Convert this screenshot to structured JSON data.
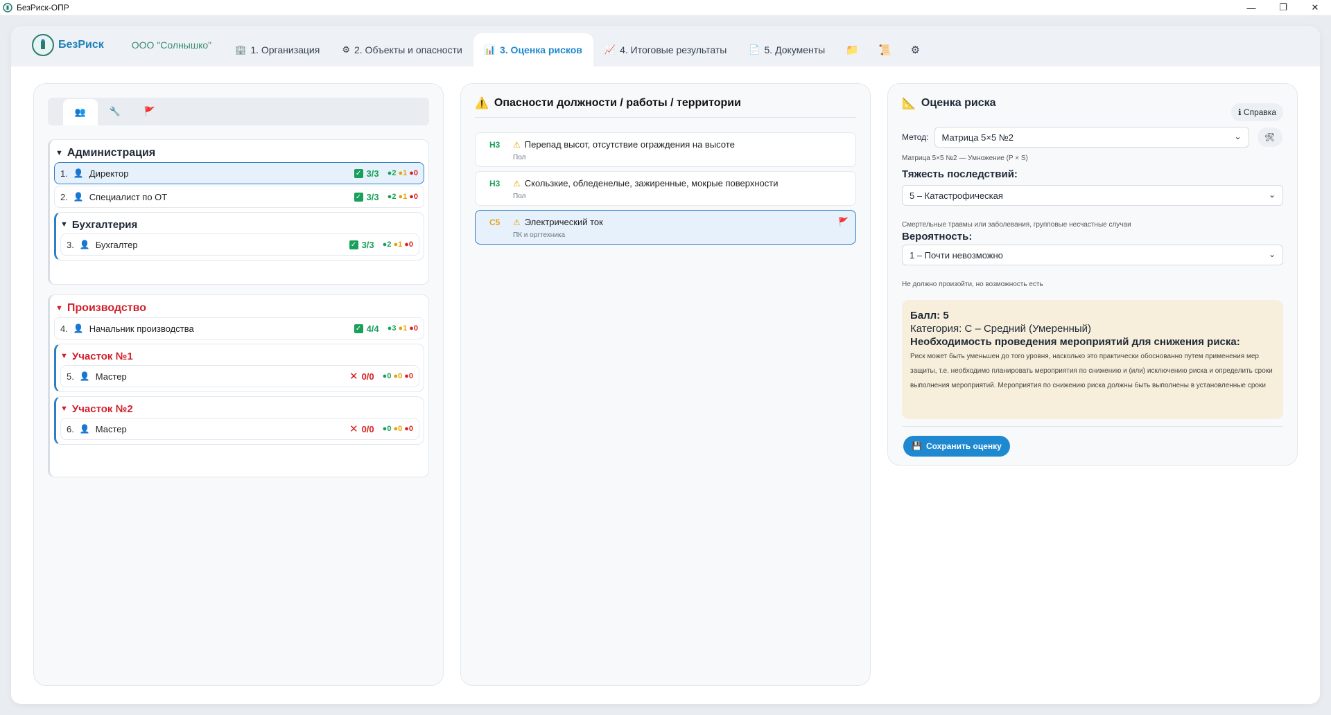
{
  "window": {
    "title": "БезРиск-ОПР",
    "controls": {
      "minimize": "—",
      "maximize": "❐",
      "close": "✕"
    }
  },
  "nav": {
    "brand": "БезРиск",
    "org": "ООО \"Солнышко\"",
    "tabs": [
      {
        "icon": "building-icon",
        "glyph": "🏢",
        "label": "1. Организация"
      },
      {
        "icon": "gear-icon",
        "glyph": "⚙",
        "label": "2. Объекты и опасности"
      },
      {
        "icon": "bar-chart-icon",
        "glyph": "📊",
        "label": "3. Оценка рисков",
        "active": true
      },
      {
        "icon": "trend-chart-icon",
        "glyph": "📈",
        "label": "4. Итоговые результаты"
      },
      {
        "icon": "document-icon",
        "glyph": "📄",
        "label": "5. Документы"
      }
    ],
    "extra_icons": [
      {
        "icon": "folder-icon",
        "glyph": "📁"
      },
      {
        "icon": "scroll-icon",
        "glyph": "📜"
      },
      {
        "icon": "settings-icon",
        "glyph": "⚙"
      }
    ]
  },
  "left": {
    "filter_tabs": [
      {
        "icon": "people-icon",
        "glyph": "👥",
        "active": true
      },
      {
        "icon": "wrench-icon",
        "glyph": "🔧"
      },
      {
        "icon": "flag-icon",
        "glyph": "🚩"
      }
    ],
    "groups": [
      {
        "title": "Администрация",
        "items": [
          {
            "num": "1.",
            "name": "Директор",
            "ratio": "3/3",
            "ok": true,
            "g": "2",
            "o": "1",
            "r": "0",
            "selected": true
          },
          {
            "num": "2.",
            "name": "Специалист по ОТ",
            "ratio": "3/3",
            "ok": true,
            "g": "2",
            "o": "1",
            "r": "0"
          }
        ],
        "subgroups": [
          {
            "title": "Бухгалтерия",
            "items": [
              {
                "num": "3.",
                "name": "Бухгалтер",
                "ratio": "3/3",
                "ok": true,
                "g": "2",
                "o": "1",
                "r": "0"
              }
            ]
          }
        ]
      },
      {
        "title": "Производство",
        "items": [
          {
            "num": "4.",
            "name": "Начальник производства",
            "ratio": "4/4",
            "ok": true,
            "g": "3",
            "o": "1",
            "r": "0"
          }
        ],
        "subgroups": [
          {
            "title": "Участок №1",
            "items": [
              {
                "num": "5.",
                "name": "Мастер",
                "ratio": "0/0",
                "ok": false,
                "g": "0",
                "o": "0",
                "r": "0"
              }
            ]
          },
          {
            "title": "Участок №2",
            "items": [
              {
                "num": "6.",
                "name": "Мастер",
                "ratio": "0/0",
                "ok": false,
                "g": "0",
                "o": "0",
                "r": "0"
              }
            ]
          }
        ]
      }
    ]
  },
  "mid": {
    "title": "Опасности должности / работы / территории",
    "hazards": [
      {
        "code": "Н3",
        "title": "Перепад высот, отсутствие ограждения на высоте",
        "sub": "Пол"
      },
      {
        "code": "Н3",
        "title": "Скользкие, обледенелые, зажиренные, мокрые поверхности",
        "sub": "Пол"
      },
      {
        "code": "С5",
        "title": "Электрический ток",
        "sub": "ПК и оргтехника",
        "selected": true
      }
    ]
  },
  "right": {
    "title": "Оценка риска",
    "help": "ℹ Справка",
    "method_label": "Метод:",
    "method_value": "Матрица 5×5 №2",
    "method_hint": "Матрица 5×5 №2 — Умножение (P × S)",
    "severity_label": "Тяжесть последствий:",
    "severity_value": "5 – Катастрофическая",
    "severity_hint": "Смертельные травмы или заболевания, групповые несчастные случаи",
    "probability_label": "Вероятность:",
    "probability_value": "1 – Почти невозможно",
    "probability_hint": "Не должно произойти, но возможность есть",
    "score_line": "Балл: 5",
    "category_line": "Категория: С – Средний (Умеренный)",
    "need_line": "Необходимость проведения мероприятий для снижения риска:",
    "description": "Риск может быть уменьшен до того уровня, насколько это практически обоснованно путем применения мер защиты, т.е. необходимо планировать мероприятия по снижению и (или) исключению риска и определить сроки выполнения мероприятий. Мероприятия по снижению риска должны быть выполнены в установленные сроки",
    "save_label": "Сохранить оценку"
  }
}
